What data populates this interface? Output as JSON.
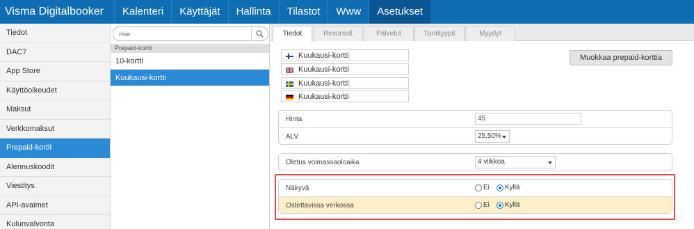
{
  "app": {
    "title": "Visma Digitalbooker"
  },
  "topnav": [
    {
      "label": "Kalenteri",
      "active": false
    },
    {
      "label": "Käyttäjät",
      "active": false
    },
    {
      "label": "Hallinta",
      "active": false
    },
    {
      "label": "Tilastot",
      "active": false
    },
    {
      "label": "Www",
      "active": false
    },
    {
      "label": "Asetukset",
      "active": true
    }
  ],
  "sidebar": {
    "items": [
      {
        "label": "Tiedot"
      },
      {
        "label": "DAC7"
      },
      {
        "label": "App Store"
      },
      {
        "label": "Käyttöoikeudet"
      },
      {
        "label": "Maksut"
      },
      {
        "label": "Verkkomaksut"
      },
      {
        "label": "Prepaid-kortit",
        "active": true
      },
      {
        "label": "Alennuskoodit"
      },
      {
        "label": "Viestitys"
      },
      {
        "label": "API-avaimet"
      },
      {
        "label": "Kulunvalvonta"
      }
    ]
  },
  "list": {
    "search_placeholder": "Hae",
    "search_icon": "search-icon",
    "group_label": "Prepaid-kortit",
    "items": [
      {
        "label": "10-kortti"
      },
      {
        "label": "Kuukausi-kortti",
        "active": true
      }
    ]
  },
  "tabs": [
    {
      "label": "Tiedot",
      "active": true
    },
    {
      "label": "Resurssit"
    },
    {
      "label": "Palvelut"
    },
    {
      "label": "Tuntityypit"
    },
    {
      "label": "Myydyt"
    }
  ],
  "names": [
    {
      "flag": "finland-flag-icon",
      "value": "Kuukausi-kortti"
    },
    {
      "flag": "uk-flag-icon",
      "value": "Kuukausi-kortti"
    },
    {
      "flag": "sweden-flag-icon",
      "value": "Kuukausi-kortti"
    },
    {
      "flag": "germany-flag-icon",
      "value": "Kuukausi-kortti"
    }
  ],
  "edit_button": "Muokkaa prepaid-korttia",
  "price": {
    "label": "Hinta",
    "value": "45"
  },
  "vat": {
    "label": "ALV",
    "value": "25,50%"
  },
  "validity": {
    "label": "Oletus voimassaoloaika",
    "value": "4 viikkoa"
  },
  "visible": {
    "label": "Näkyvä",
    "no": "Ei",
    "yes": "Kyllä",
    "selected": "yes"
  },
  "online": {
    "label": "Ostettavissa verkossa",
    "no": "Ei",
    "yes": "Kyllä",
    "selected": "yes"
  },
  "colors": {
    "header": "#0f6db4",
    "header_active": "#0a5693",
    "selected": "#2a8ad6",
    "highlight_border": "#e04b4b",
    "highlight_row": "#fcefc9"
  }
}
